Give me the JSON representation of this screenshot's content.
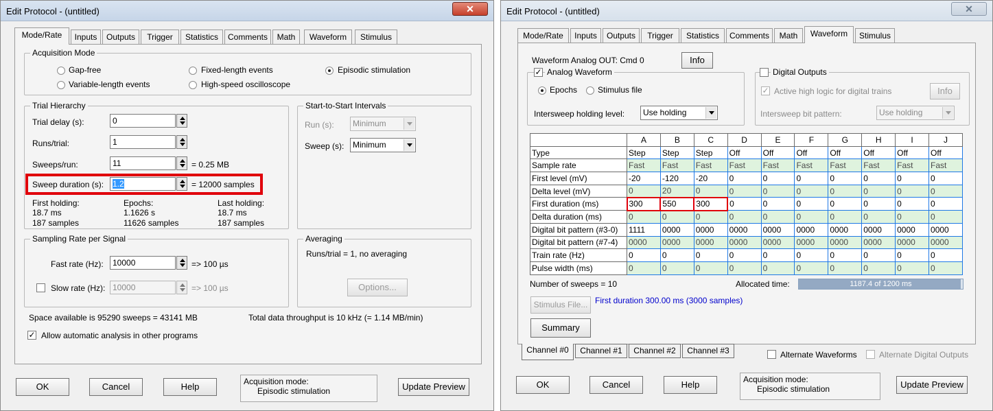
{
  "left": {
    "title": "Edit Protocol - (untitled)",
    "close_glyph": "✕",
    "tabs": [
      "Mode/Rate",
      "Inputs",
      "Outputs",
      "Trigger",
      "Statistics",
      "Comments",
      "Math",
      "Waveform",
      "Stimulus"
    ],
    "acquisition_mode": {
      "title": "Acquisition Mode",
      "options": [
        "Gap-free",
        "Variable-length events",
        "Fixed-length events",
        "High-speed oscilloscope",
        "Episodic stimulation"
      ],
      "selected": "Episodic stimulation"
    },
    "trial_hierarchy": {
      "title": "Trial Hierarchy",
      "trial_delay_label": "Trial delay (s):",
      "trial_delay_value": "0",
      "runs_label": "Runs/trial:",
      "runs_value": "1",
      "sweeps_label": "Sweeps/run:",
      "sweeps_value": "11",
      "sweeps_note": "= 0.25 MB",
      "duration_label": "Sweep duration (s):",
      "duration_value": "1.2",
      "duration_note": "= 12000 samples",
      "first_holding_label": "First holding:",
      "first_holding_ms": "18.7 ms",
      "first_holding_samples": "187 samples",
      "epochs_label": "Epochs:",
      "epochs_s": "1.1626 s",
      "epochs_samples": "11626 samples",
      "last_holding_label": "Last holding:",
      "last_holding_ms": "18.7 ms",
      "last_holding_samples": "187 samples"
    },
    "start_to_start": {
      "title": "Start-to-Start Intervals",
      "run_label": "Run (s):",
      "run_value": "Minimum",
      "sweep_label": "Sweep (s):",
      "sweep_value": "Minimum"
    },
    "sampling": {
      "title": "Sampling Rate per Signal",
      "fast_label": "Fast rate  (Hz):",
      "fast_value": "10000",
      "fast_note": "=> 100 µs",
      "slow_label": "Slow rate (Hz):",
      "slow_value": "10000",
      "slow_note": "=> 100 µs"
    },
    "averaging": {
      "title": "Averaging",
      "text": "Runs/trial = 1, no averaging",
      "options_button": "Options..."
    },
    "space_text": "Space available is 95290 sweeps = 43141 MB",
    "throughput_text": "Total data throughput is 10 kHz (= 1.14 MB/min)",
    "auto_analysis": "Allow automatic analysis in other programs",
    "buttons": {
      "ok": "OK",
      "cancel": "Cancel",
      "help": "Help",
      "update": "Update Preview"
    },
    "acq_mode_label": "Acquisition mode:",
    "acq_mode_value": "Episodic stimulation"
  },
  "right": {
    "title": "Edit Protocol - (untitled)",
    "close_glyph": "✕",
    "tabs": [
      "Mode/Rate",
      "Inputs",
      "Outputs",
      "Trigger",
      "Statistics",
      "Comments",
      "Math",
      "Waveform",
      "Stimulus"
    ],
    "analog_out": "Waveform Analog OUT:  Cmd 0",
    "info_button": "Info",
    "analog_waveform": {
      "title": "Analog Waveform",
      "epochs": "Epochs",
      "stimulus_file": "Stimulus file",
      "holding_label": "Intersweep holding level:",
      "holding_value": "Use holding"
    },
    "digital_outputs": {
      "title": "Digital Outputs",
      "active_high": "Active high logic for digital trains",
      "info_button": "Info",
      "bit_pattern_label": "Intersweep bit pattern:",
      "bit_pattern_value": "Use holding"
    },
    "epoch_table": {
      "columns": [
        "A",
        "B",
        "C",
        "D",
        "E",
        "F",
        "G",
        "H",
        "I",
        "J"
      ],
      "rows": [
        {
          "label": "Type",
          "values": [
            "Step",
            "Step",
            "Step",
            "Off",
            "Off",
            "Off",
            "Off",
            "Off",
            "Off",
            "Off"
          ]
        },
        {
          "label": "Sample rate",
          "values": [
            "Fast",
            "Fast",
            "Fast",
            "Fast",
            "Fast",
            "Fast",
            "Fast",
            "Fast",
            "Fast",
            "Fast"
          ]
        },
        {
          "label": "First level (mV)",
          "values": [
            "-20",
            "-120",
            "-20",
            "0",
            "0",
            "0",
            "0",
            "0",
            "0",
            "0"
          ]
        },
        {
          "label": "Delta level (mV)",
          "values": [
            "0",
            "20",
            "0",
            "0",
            "0",
            "0",
            "0",
            "0",
            "0",
            "0"
          ]
        },
        {
          "label": "First duration (ms)",
          "values": [
            "300",
            "550",
            "300",
            "0",
            "0",
            "0",
            "0",
            "0",
            "0",
            "0"
          ]
        },
        {
          "label": "Delta duration (ms)",
          "values": [
            "0",
            "0",
            "0",
            "0",
            "0",
            "0",
            "0",
            "0",
            "0",
            "0"
          ]
        },
        {
          "label": "Digital bit pattern (#3-0)",
          "values": [
            "1111",
            "0000",
            "0000",
            "0000",
            "0000",
            "0000",
            "0000",
            "0000",
            "0000",
            "0000"
          ]
        },
        {
          "label": "Digital bit pattern (#7-4)",
          "values": [
            "0000",
            "0000",
            "0000",
            "0000",
            "0000",
            "0000",
            "0000",
            "0000",
            "0000",
            "0000"
          ]
        },
        {
          "label": "Train rate (Hz)",
          "values": [
            "0",
            "0",
            "0",
            "0",
            "0",
            "0",
            "0",
            "0",
            "0",
            "0"
          ]
        },
        {
          "label": "Pulse width (ms)",
          "values": [
            "0",
            "0",
            "0",
            "0",
            "0",
            "0",
            "0",
            "0",
            "0",
            "0"
          ]
        }
      ]
    },
    "num_sweeps": "Number of sweeps = 10",
    "allocated_label": "Allocated time:",
    "allocated_text": "1187.4 of 1200 ms",
    "allocated_fraction": 0.9895,
    "stimulus_file_button": "Stimulus File...",
    "status_text": "First duration 300.00 ms (3000 samples)",
    "summary_button": "Summary",
    "channel_tabs": [
      "Channel #0",
      "Channel #1",
      "Channel #2",
      "Channel #3"
    ],
    "alternate_waveforms": "Alternate Waveforms",
    "alternate_digital": "Alternate Digital Outputs",
    "buttons": {
      "ok": "OK",
      "cancel": "Cancel",
      "help": "Help",
      "update": "Update Preview"
    },
    "acq_mode_label": "Acquisition mode:",
    "acq_mode_value": "Episodic stimulation"
  },
  "colors": {
    "highlight_red": "#e0000b",
    "grid_blue": "#1e78e6",
    "row_green": "#dff3de",
    "status_blue": "#0000cc",
    "progress_fill": "#94a9c3"
  }
}
